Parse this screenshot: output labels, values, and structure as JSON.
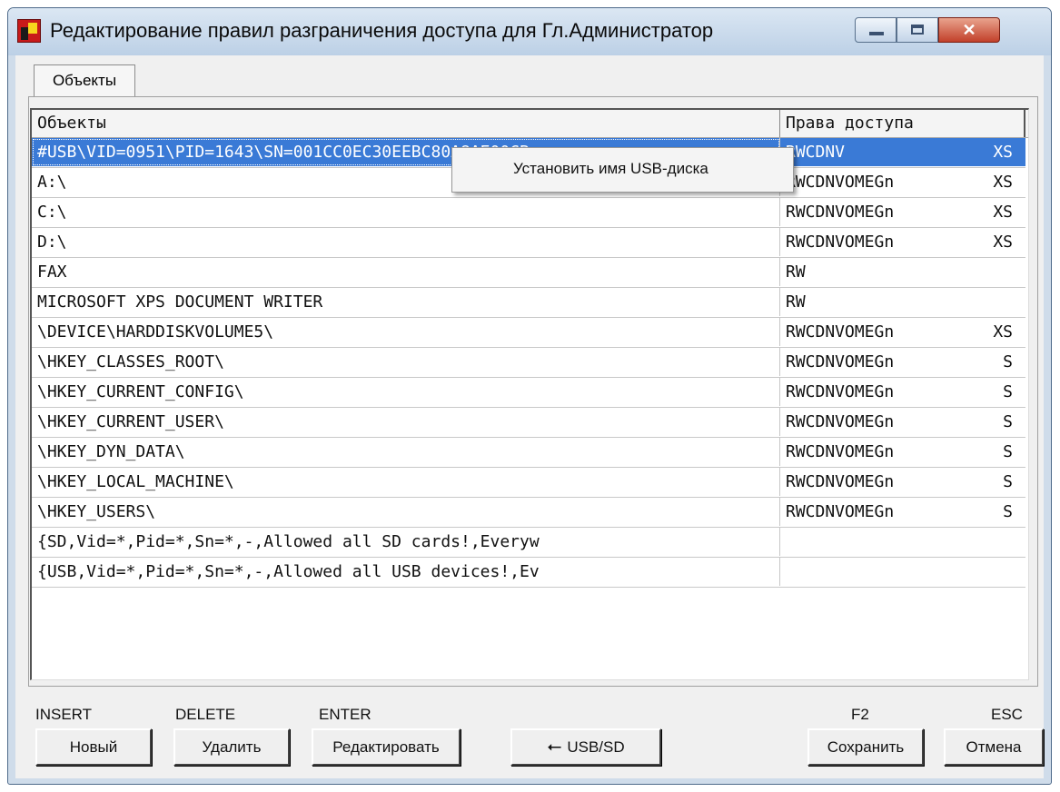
{
  "window": {
    "title": "Редактирование правил разграничения доступа для Гл.Администратор",
    "close_glyph": "✕",
    "app_icon": "app-shield-icon"
  },
  "tabs": [
    "Объекты"
  ],
  "grid": {
    "columns": [
      "Объекты",
      "Права доступа"
    ],
    "rows": [
      {
        "object": "#USB\\VID=0951\\PID=1643\\SN=001CC0EC30EEBC80A8AE00CB",
        "rights": "RWCDNV",
        "flags": "XS",
        "selected": true
      },
      {
        "object": "A:\\",
        "rights": "RWCDNVOMEGn",
        "flags": "XS"
      },
      {
        "object": "C:\\",
        "rights": "RWCDNVOMEGn",
        "flags": "XS"
      },
      {
        "object": "D:\\",
        "rights": "RWCDNVOMEGn",
        "flags": "XS"
      },
      {
        "object": "FAX",
        "rights": "RW",
        "flags": ""
      },
      {
        "object": "MICROSOFT XPS DOCUMENT WRITER",
        "rights": "RW",
        "flags": ""
      },
      {
        "object": "\\DEVICE\\HARDDISKVOLUME5\\",
        "rights": "RWCDNVOMEGn",
        "flags": "XS"
      },
      {
        "object": "\\HKEY_CLASSES_ROOT\\",
        "rights": "RWCDNVOMEGn",
        "flags": "S"
      },
      {
        "object": "\\HKEY_CURRENT_CONFIG\\",
        "rights": "RWCDNVOMEGn",
        "flags": "S"
      },
      {
        "object": "\\HKEY_CURRENT_USER\\",
        "rights": "RWCDNVOMEGn",
        "flags": "S"
      },
      {
        "object": "\\HKEY_DYN_DATA\\",
        "rights": "RWCDNVOMEGn",
        "flags": "S"
      },
      {
        "object": "\\HKEY_LOCAL_MACHINE\\",
        "rights": "RWCDNVOMEGn",
        "flags": "S"
      },
      {
        "object": "\\HKEY_USERS\\",
        "rights": "RWCDNVOMEGn",
        "flags": "S"
      },
      {
        "object": "{SD,Vid=*,Pid=*,Sn=*,-,Allowed all SD cards!,Everyw",
        "rights": "",
        "flags": ""
      },
      {
        "object": "{USB,Vid=*,Pid=*,Sn=*,-,Allowed all USB devices!,Ev",
        "rights": "",
        "flags": ""
      }
    ]
  },
  "context_menu": {
    "items": [
      "Установить имя USB-диска"
    ]
  },
  "hotkeys": {
    "insert": "INSERT",
    "delete": "DELETE",
    "enter": "ENTER",
    "f2": "F2",
    "esc": "ESC"
  },
  "buttons": {
    "new": "Новый",
    "delete": "Удалить",
    "edit": "Редактировать",
    "usb_sd": "USB/SD",
    "usb_icon": "usb-icon",
    "save": "Сохранить",
    "cancel": "Отмена"
  }
}
